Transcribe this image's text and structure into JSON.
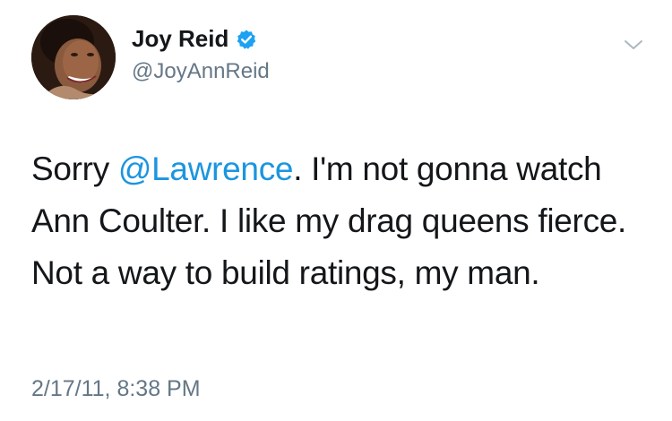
{
  "author": {
    "display_name": "Joy Reid",
    "handle": "@JoyAnnReid",
    "verified": true,
    "verified_icon": "verified-badge-icon",
    "avatar": "profile-photo"
  },
  "menu": {
    "icon": "chevron-down-icon"
  },
  "tweet": {
    "text_before": "Sorry ",
    "mention": "@Lawrence",
    "text_after": ". I'm not gonna watch Ann Coulter. I like my drag queens fierce. Not a way to build ratings, my man.",
    "timestamp": "2/17/11, 8:38 PM"
  },
  "colors": {
    "link": "#1b95e0",
    "verified": "#1da1f2",
    "secondary_text": "#657786",
    "primary_text": "#14171a"
  }
}
